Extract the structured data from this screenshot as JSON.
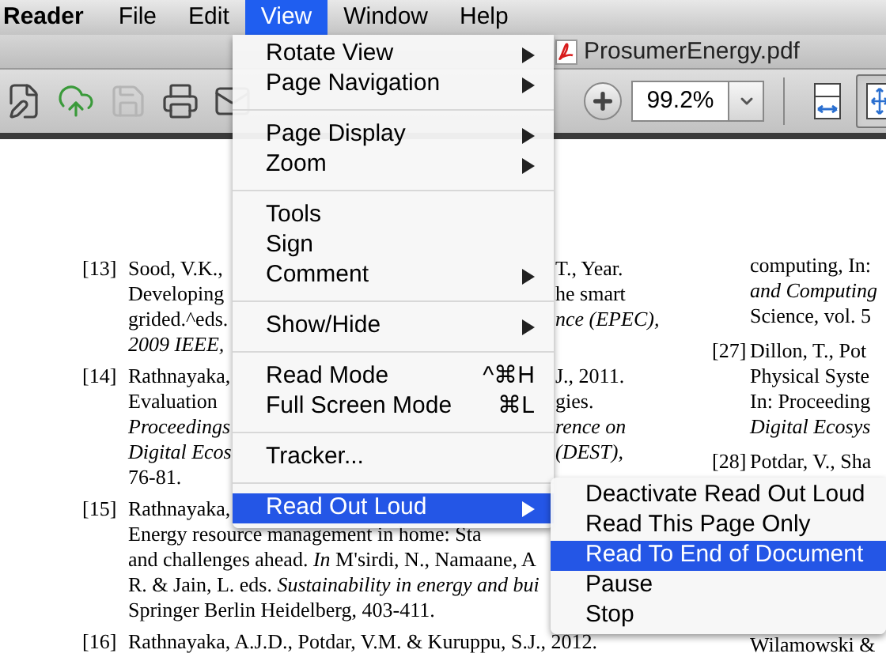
{
  "menu_bar": [
    {
      "label": "Reader",
      "selected": false,
      "kind": "app"
    },
    {
      "label": "File",
      "selected": false,
      "kind": "menu"
    },
    {
      "label": "Edit",
      "selected": false,
      "kind": "menu"
    },
    {
      "label": "View",
      "selected": true,
      "kind": "menu"
    },
    {
      "label": "Window",
      "selected": false,
      "kind": "menu"
    },
    {
      "label": "Help",
      "selected": false,
      "kind": "menu"
    }
  ],
  "tab": {
    "title": "ProsumerEnergy.pdf"
  },
  "toolbar": {
    "left_buttons": [
      {
        "kind": "edit",
        "disabled": false
      },
      {
        "kind": "upload",
        "disabled": false
      },
      {
        "kind": "save",
        "disabled": true
      },
      {
        "kind": "print",
        "disabled": false
      },
      {
        "kind": "mail",
        "disabled": false
      }
    ],
    "zoom": {
      "value": "99.2%"
    },
    "view_buttons": [
      {
        "kind": "fit-width",
        "selected": false
      },
      {
        "kind": "fit-page",
        "selected": true
      }
    ]
  },
  "document": {
    "left_rows": [
      {
        "num": "[13]",
        "new_ref": false,
        "a": {
          "text": "Sood, V.K.,",
          "italic": false
        },
        "b": {
          "text": "T., Year.",
          "italic": false
        }
      },
      {
        "new_ref": false,
        "a": {
          "text": "Developing",
          "italic": false
        },
        "b": {
          "text": "he smart",
          "italic": false
        }
      },
      {
        "new_ref": false,
        "a": {
          "text": "grided.^eds.",
          "italic": false
        },
        "b": {
          "text": "nce (EPEC),",
          "italic": true
        }
      },
      {
        "new_ref": false,
        "a": {
          "text": "2009 IEEE,",
          "italic": true
        }
      },
      {
        "num": "[14]",
        "new_ref": true,
        "a": {
          "text": "Rathnayaka,",
          "italic": false
        },
        "b": {
          "text": "J., 2011.",
          "italic": false
        }
      },
      {
        "new_ref": false,
        "a": {
          "text": "Evaluation",
          "italic": false
        },
        "b": {
          "text": "gies.",
          "italic": false
        }
      },
      {
        "new_ref": false,
        "a": {
          "text": "Proceedings",
          "italic": true
        },
        "b": {
          "text": "rence on",
          "italic": true
        }
      },
      {
        "new_ref": false,
        "a": {
          "text": "Digital Ecos",
          "italic": true
        },
        "b": {
          "text": "(DEST),",
          "italic": true
        }
      },
      {
        "new_ref": false,
        "a": {
          "text": "76-81.",
          "italic": false
        }
      },
      {
        "num": "[15]",
        "new_ref": true,
        "a": {
          "text": "Rathnayaka,",
          "italic": false
        }
      },
      {
        "new_ref": false,
        "a": {
          "text": "Energy resource management in home: Sta",
          "italic": false
        }
      },
      {
        "new_ref": false,
        "a": {
          "text": "and challenges ahead. *In* M'sirdi, N., Namaane, A",
          "italic": false
        }
      },
      {
        "new_ref": false,
        "a": {
          "text": "R. & Jain, L. eds. *Sustainability in energy and bui*",
          "italic": false
        }
      },
      {
        "new_ref": false,
        "a": {
          "text": "Springer Berlin Heidelberg, 403-411.",
          "italic": false
        }
      },
      {
        "num": "[16]",
        "new_ref": true,
        "a": {
          "text": "Rathnayaka, A.J.D., Potdar, V.M. & Kuruppu, S.J., 2012.",
          "italic": false
        }
      }
    ],
    "right_top": [
      {
        "text": "computing, In:",
        "italic": false
      },
      {
        "text": "and Computing",
        "italic": true
      },
      {
        "text": "Science, vol. 5",
        "italic": false
      },
      {
        "num": "[27]",
        "text": "Dillon, T., Pot",
        "italic": false
      },
      {
        "text": "Physical Syste",
        "italic": false
      },
      {
        "text": "In: Proceeding",
        "italic": false
      },
      {
        "text": "Digital Ecosys",
        "italic": true
      },
      {
        "num": "[28]",
        "text": "Potdar, V., Sha",
        "italic": false
      }
    ],
    "right_bottom": [
      {
        "text": "Wilamowski &",
        "italic": false
      }
    ]
  },
  "view_menu": [
    {
      "kind": "item",
      "label": "Rotate View",
      "submenu": true,
      "selected": false
    },
    {
      "kind": "item",
      "label": "Page Navigation",
      "submenu": true,
      "selected": false
    },
    {
      "kind": "separator"
    },
    {
      "kind": "item",
      "label": "Page Display",
      "submenu": true,
      "selected": false
    },
    {
      "kind": "item",
      "label": "Zoom",
      "submenu": true,
      "selected": false
    },
    {
      "kind": "separator"
    },
    {
      "kind": "item",
      "label": "Tools",
      "submenu": false,
      "selected": false
    },
    {
      "kind": "item",
      "label": "Sign",
      "submenu": false,
      "selected": false
    },
    {
      "kind": "item",
      "label": "Comment",
      "submenu": true,
      "selected": false
    },
    {
      "kind": "separator"
    },
    {
      "kind": "item",
      "label": "Show/Hide",
      "submenu": true,
      "selected": false
    },
    {
      "kind": "separator"
    },
    {
      "kind": "item",
      "label": "Read Mode",
      "shortcut": "^⌘H",
      "submenu": false,
      "selected": false
    },
    {
      "kind": "item",
      "label": "Full Screen Mode",
      "shortcut": "⌘L",
      "submenu": false,
      "selected": false
    },
    {
      "kind": "separator"
    },
    {
      "kind": "item",
      "label": "Tracker...",
      "submenu": false,
      "selected": false
    },
    {
      "kind": "separator"
    },
    {
      "kind": "item",
      "label": "Read Out Loud",
      "submenu": true,
      "selected": true
    }
  ],
  "read_out_loud_menu": [
    {
      "label": "Deactivate Read Out Loud",
      "selected": false
    },
    {
      "label": "Read This Page Only",
      "selected": false
    },
    {
      "label": "Read To End of Document",
      "selected": true
    },
    {
      "label": "Pause",
      "selected": false
    },
    {
      "label": "Stop",
      "selected": false
    }
  ]
}
